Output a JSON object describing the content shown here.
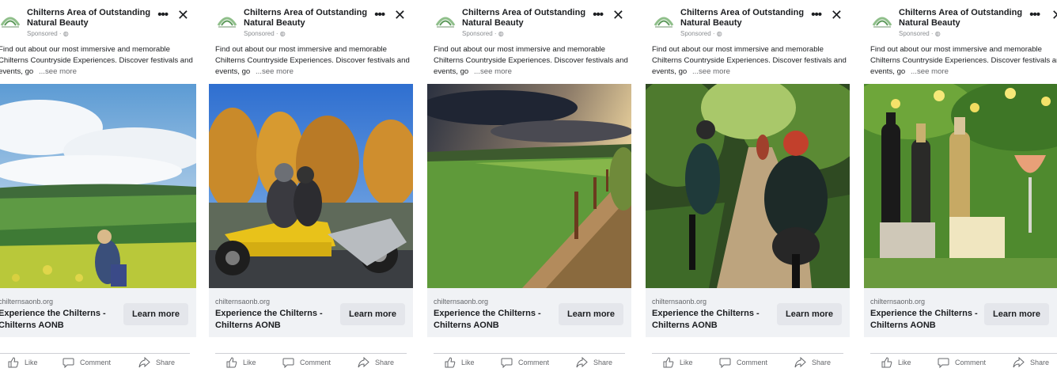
{
  "ads": [
    {
      "advertiser": "Chilterns Area of Outstanding Natural Beauty",
      "sponsored": "Sponsored · ◍",
      "body": "Find out about our most immersive and memorable Chilterns Countryside Experiences. Discover festivals and events, go",
      "see_more": "...see more",
      "image": "woman-photographing-countryside",
      "domain": "chilternsaonb.org",
      "headline": "Experience the Chilterns - Chilterns AONB",
      "cta": "Learn more"
    },
    {
      "advertiser": "Chilterns Area of Outstanding Natural Beauty",
      "sponsored": "Sponsored · ◍",
      "body": "Find out about our most immersive and memorable Chilterns Countryside Experiences. Discover festivals and events, go",
      "see_more": "...see more",
      "image": "yellow-trike-autumn-trees",
      "domain": "chilternsaonb.org",
      "headline": "Experience the Chilterns - Chilterns AONB",
      "cta": "Learn more"
    },
    {
      "advertiser": "Chilterns Area of Outstanding Natural Beauty",
      "sponsored": "Sponsored · ◍",
      "body": "Find out about our most immersive and memorable Chilterns Countryside Experiences. Discover festivals and events, go",
      "see_more": "...see more",
      "image": "green-field-fence-sky",
      "domain": "chilternsaonb.org",
      "headline": "Experience the Chilterns - Chilterns AONB",
      "cta": "Learn more"
    },
    {
      "advertiser": "Chilterns Area of Outstanding Natural Beauty",
      "sponsored": "Sponsored · ◍",
      "body": "Find out about our most immersive and memorable Chilterns Countryside Experiences. Discover festivals and events, go",
      "see_more": "...see more",
      "image": "cyclists-woodland-path",
      "domain": "chilternsaonb.org",
      "headline": "Experience the Chilterns - Chilterns AONB",
      "cta": "Learn more"
    },
    {
      "advertiser": "Chilterns Area of Outstanding Natural Beauty",
      "sponsored": "Sponsored · ◍",
      "body": "Find out about our most immersive and memorable Chilterns Countryside Experiences. Discover festivals and events, go",
      "see_more": "...see more",
      "image": "wine-cheese-picnic",
      "domain": "chilternsaonb.org",
      "headline": "Experience the Chilterns - Chilterns AONB",
      "cta": "Learn more"
    }
  ],
  "actions": {
    "like": "Like",
    "comment": "Comment",
    "share": "Share"
  },
  "icons": {
    "more": "more-dots-icon",
    "close": "close-icon",
    "like": "thumbs-up-icon",
    "comment": "comment-bubble-icon",
    "share": "share-arrow-icon"
  },
  "colors": {
    "card_bg": "#ffffff",
    "cta_bg": "#f0f2f5",
    "button_bg": "#e4e6eb",
    "text": "#1c1e21",
    "muted": "#65676b"
  }
}
